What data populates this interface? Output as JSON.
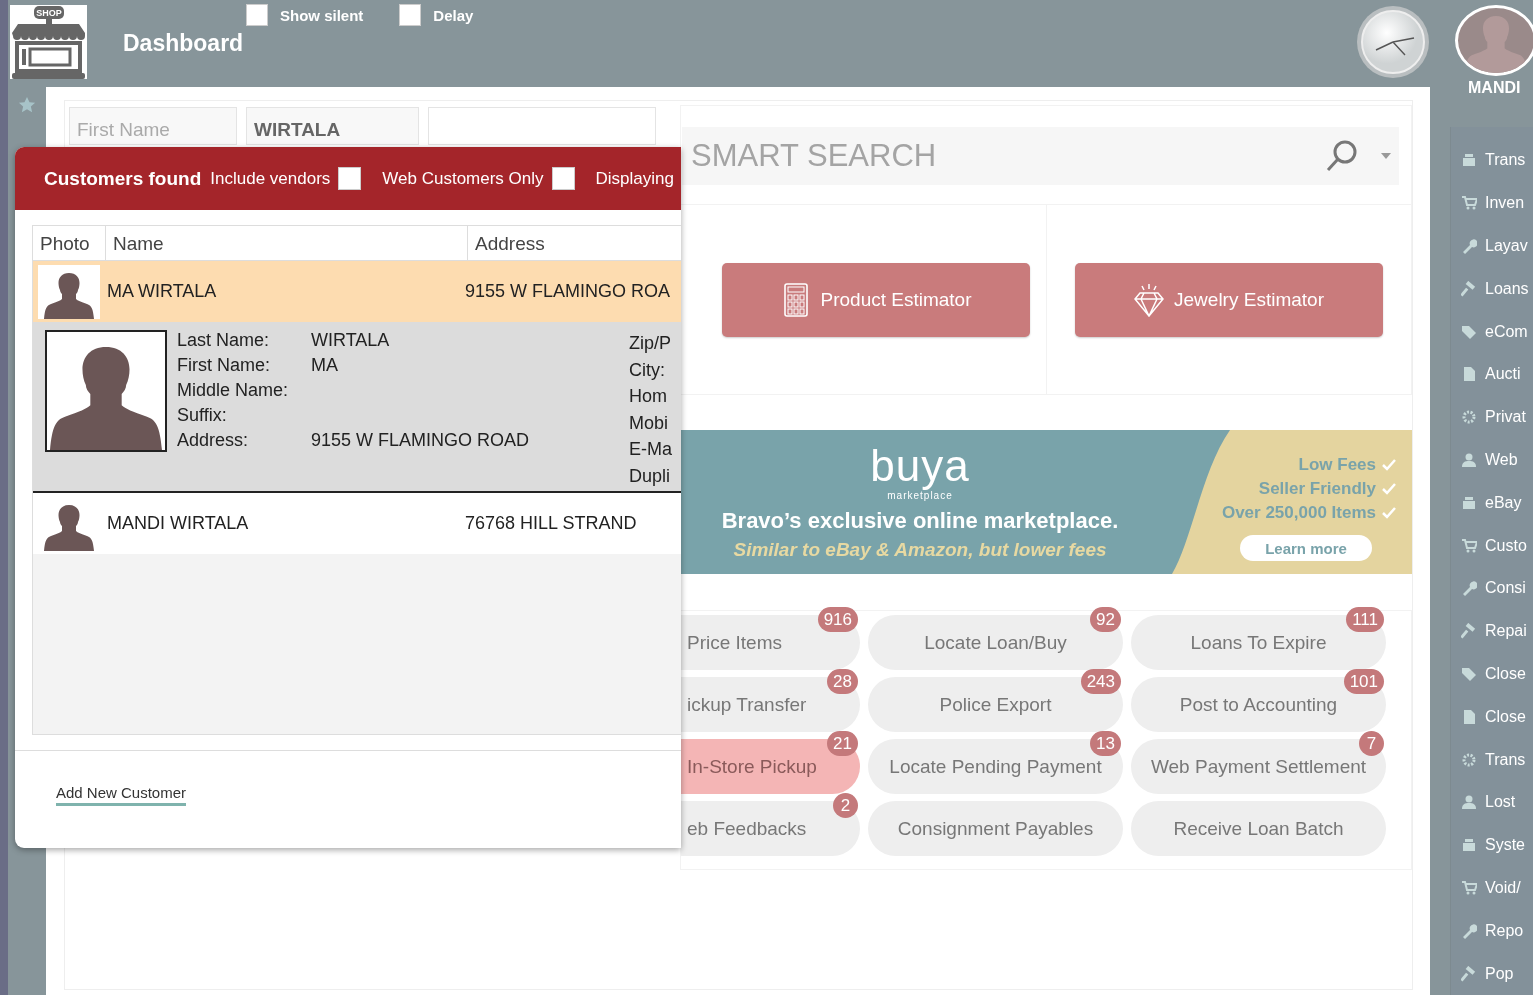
{
  "header": {
    "logo_text": "SHOP",
    "title": "Dashboard",
    "options": [
      {
        "label": "Show silent",
        "checked": false
      },
      {
        "label": "Delay",
        "checked": false
      }
    ]
  },
  "user": {
    "name": "MANDI"
  },
  "search_form": {
    "fields": [
      {
        "placeholder": "First Name"
      },
      {
        "value": "WIRTALA"
      }
    ]
  },
  "dialog": {
    "title": "Customers found",
    "options": [
      {
        "label": "Include vendors",
        "checked": false
      },
      {
        "label": "Web Customers Only",
        "checked": false
      }
    ],
    "status": "Displaying",
    "columns": [
      "Photo",
      "Name",
      "Address"
    ],
    "rows": [
      {
        "name": "MA WIRTALA",
        "address": "9155 W FLAMINGO ROA",
        "selected": true,
        "expanded": true,
        "details": [
          {
            "label": "Last Name:",
            "value": "WIRTALA"
          },
          {
            "label": "First Name:",
            "value": "MA"
          },
          {
            "label": "Middle Name:"
          },
          {
            "label": "Suffix:"
          },
          {
            "label": "Address:",
            "value": "9155 W FLAMINGO ROAD"
          }
        ],
        "more_labels": [
          "Zip/P",
          "City:",
          "Hom",
          "Mobi",
          "E-Ma",
          "Dupli"
        ]
      },
      {
        "name": "MANDI WIRTALA",
        "address": "76768 HILL STRAND",
        "selected": false,
        "expanded": false
      }
    ],
    "add_link": "Add New Customer"
  },
  "smart_search": {
    "placeholder": "SMART SEARCH"
  },
  "estimators": [
    "Product Estimator",
    "Jewelry Estimator"
  ],
  "banner": {
    "logo": "buya",
    "logo_sub": "marketplace",
    "headline": "Bravo’s exclusive online marketplace.",
    "tagline": "Similar to eBay & Amazon, but lower fees",
    "points": [
      "Low Fees",
      "Seller Friendly",
      "Over 250,000 Items"
    ],
    "button": "Learn more"
  },
  "quick_actions": [
    {
      "label": "Price Items",
      "count": "916",
      "selected": false
    },
    {
      "label": "Locate Loan/Buy",
      "count": "92",
      "selected": false
    },
    {
      "label": "Loans To Expire",
      "count": "111",
      "selected": false
    },
    {
      "label": "ickup Transfer",
      "count": "28",
      "selected": false
    },
    {
      "label": "Police Export",
      "count": "243",
      "selected": false
    },
    {
      "label": "Post to Accounting",
      "count": "101",
      "selected": false
    },
    {
      "label": "In-Store Pickup",
      "count": "21",
      "selected": true
    },
    {
      "label": "Locate Pending Payment",
      "count": "13",
      "selected": false
    },
    {
      "label": "Web Payment Settlement",
      "count": "7",
      "selected": false
    },
    {
      "label": "eb Feedbacks",
      "count": "2",
      "selected": false
    },
    {
      "label": "Consignment Payables",
      "selected": false
    },
    {
      "label": "Receive Loan Batch",
      "selected": false
    }
  ],
  "sidebar": {
    "items": [
      "Trans",
      "Inven",
      "Layav",
      "Loans",
      "eCom",
      "Aucti",
      "Privat",
      "Web",
      "eBay",
      "Custo",
      "Consi",
      "Repai",
      "Close",
      "Close",
      "Trans",
      "Lost",
      "Syste",
      "Void/",
      "Repo",
      "Pop"
    ]
  }
}
